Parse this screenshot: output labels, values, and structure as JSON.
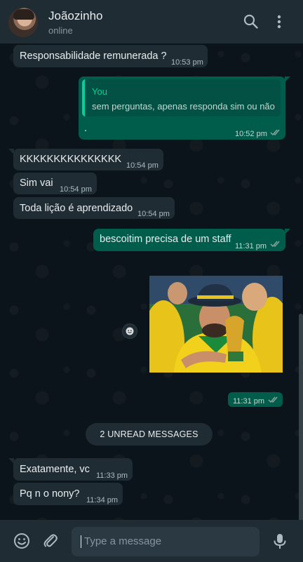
{
  "header": {
    "contact_name": "Joãozinho",
    "status": "online"
  },
  "messages": [
    {
      "text": "Responsabilidade remunerada ?",
      "time": "10:53 pm"
    },
    {
      "quote_author": "You",
      "quote_text": "sem perguntas, apenas responda sim ou não",
      "text": ".",
      "time": "10:52 pm"
    },
    {
      "text": "KKKKKKKKKKKKKKK",
      "time": "10:54 pm"
    },
    {
      "text": "Sim vai",
      "time": "10:54 pm"
    },
    {
      "text": "Toda lição é aprendizado",
      "time": "10:54 pm"
    },
    {
      "text": "bescoitim precisa de um staff",
      "time": "11:31 pm"
    },
    {
      "image": "fan-with-trophy-photo",
      "time": "11:31 pm"
    },
    {
      "text": "Exatamente, vc",
      "time": "11:33 pm"
    },
    {
      "text": "Pq n o nony?",
      "time": "11:34 pm"
    }
  ],
  "unread_banner": "2 UNREAD MESSAGES",
  "composer": {
    "placeholder": "Type a message"
  },
  "icons": {
    "search": "search-icon",
    "menu": "kebab-menu-icon",
    "emoji": "emoji-icon",
    "attach": "paperclip-icon",
    "mic": "microphone-icon",
    "read_receipt": "double-check-icon",
    "reaction": "emoji-reaction-icon"
  },
  "colors": {
    "background": "#0b141a",
    "header": "#1f2c34",
    "incoming_bubble": "#1f2c34",
    "outgoing_bubble": "#005c4b",
    "accent": "#06cf9c",
    "read_ticks": "#8fa9a0"
  }
}
